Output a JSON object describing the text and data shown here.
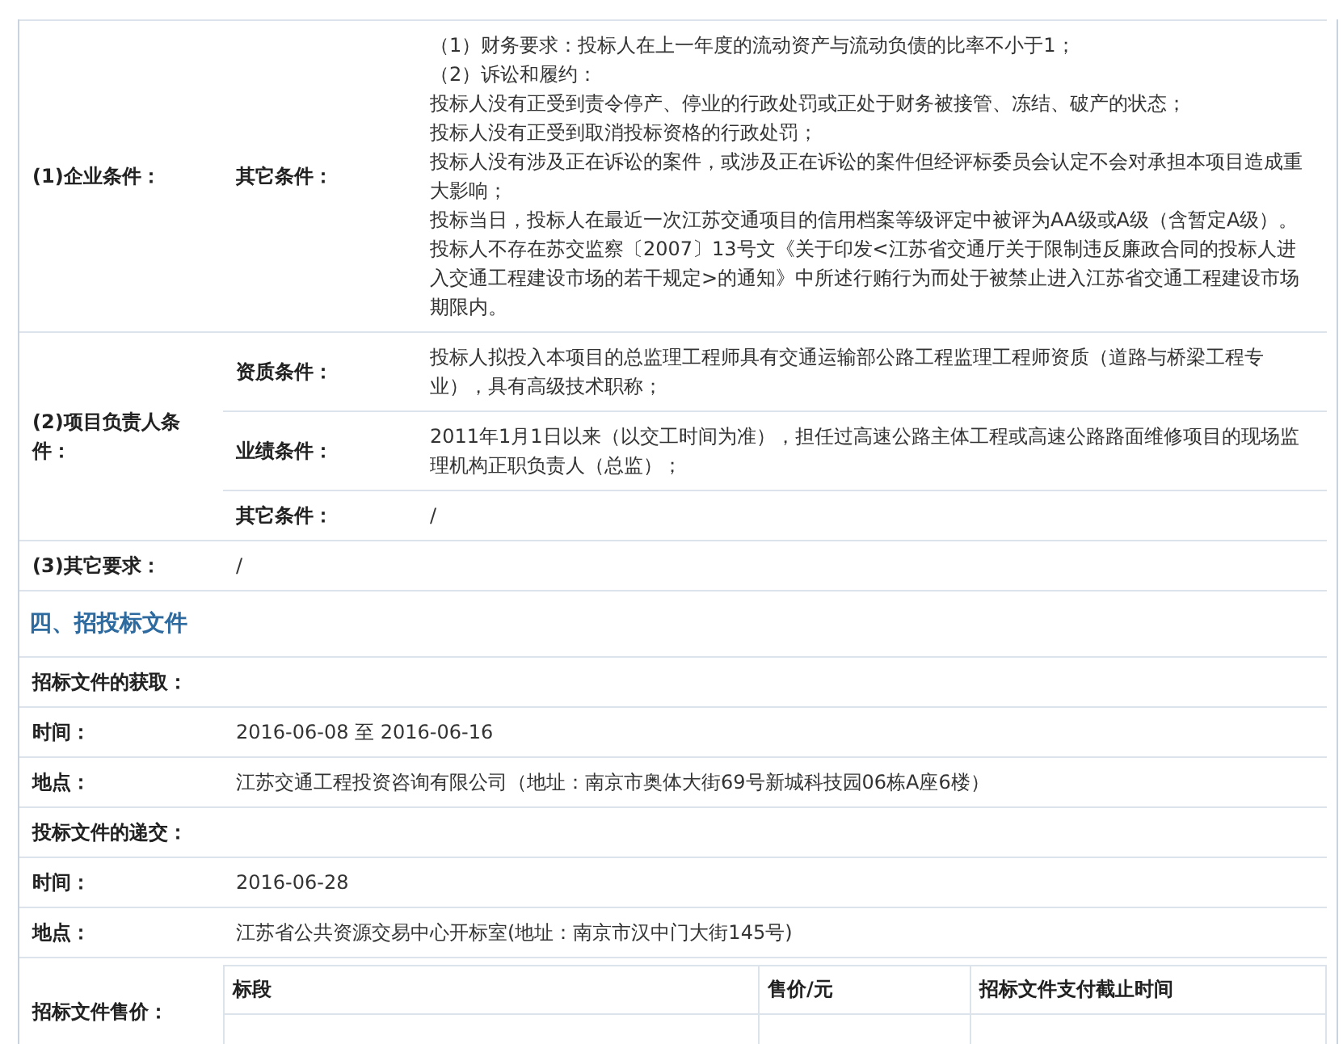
{
  "requirements": [
    {
      "label": "(1)企业条件：",
      "subrows": [
        {
          "label": "其它条件：",
          "lines": [
            "（1）财务要求：投标人在上一年度的流动资产与流动负债的比率不小于1；",
            "（2）诉讼和履约：",
            "投标人没有正受到责令停产、停业的行政处罚或正处于财务被接管、冻结、破产的状态；",
            "投标人没有正受到取消投标资格的行政处罚；",
            "投标人没有涉及正在诉讼的案件，或涉及正在诉讼的案件但经评标委员会认定不会对承担本项目造成重大影响；",
            "投标当日，投标人在最近一次江苏交通项目的信用档案等级评定中被评为AA级或A级（含暂定A级）。投标人不存在苏交监察〔2007〕13号文《关于印发<江苏省交通厅关于限制违反廉政合同的投标人进入交通工程建设市场的若干规定>的通知》中所述行贿行为而处于被禁止进入江苏省交通工程建设市场期限内。"
          ]
        }
      ]
    },
    {
      "label": "(2)项目负责人条件：",
      "subrows": [
        {
          "label": "资质条件：",
          "lines": [
            "投标人拟投入本项目的总监理工程师具有交通运输部公路工程监理工程师资质（道路与桥梁工程专业），具有高级技术职称；"
          ]
        },
        {
          "label": "业绩条件：",
          "lines": [
            "2011年1月1日以来（以交工时间为准），担任过高速公路主体工程或高速公路路面维修项目的现场监理机构正职负责人（总监）；"
          ]
        },
        {
          "label": "其它条件：",
          "lines": [
            "/"
          ]
        }
      ]
    },
    {
      "label": "(3)其它要求：",
      "value": "/"
    }
  ],
  "section_title": "四、招投标文件",
  "doc_rows": [
    {
      "kind": "heading",
      "label": "招标文件的获取："
    },
    {
      "kind": "field",
      "label": "时间：",
      "value": "2016-06-08 至 2016-06-16"
    },
    {
      "kind": "field",
      "label": "地点：",
      "value": "江苏交通工程投资咨询有限公司（地址：南京市奥体大街69号新城科技园06栋A座6楼）"
    },
    {
      "kind": "heading",
      "label": "投标文件的递交："
    },
    {
      "kind": "field",
      "label": "时间：",
      "value": "2016-06-28"
    },
    {
      "kind": "field",
      "label": "地点：",
      "value": "江苏省公共资源交易中心开标室(地址：南京市汉中门大街145号)"
    },
    {
      "kind": "table",
      "label": "招标文件售价：",
      "columns": [
        "标段",
        "售价/元",
        "招标文件支付截止时间"
      ]
    }
  ]
}
